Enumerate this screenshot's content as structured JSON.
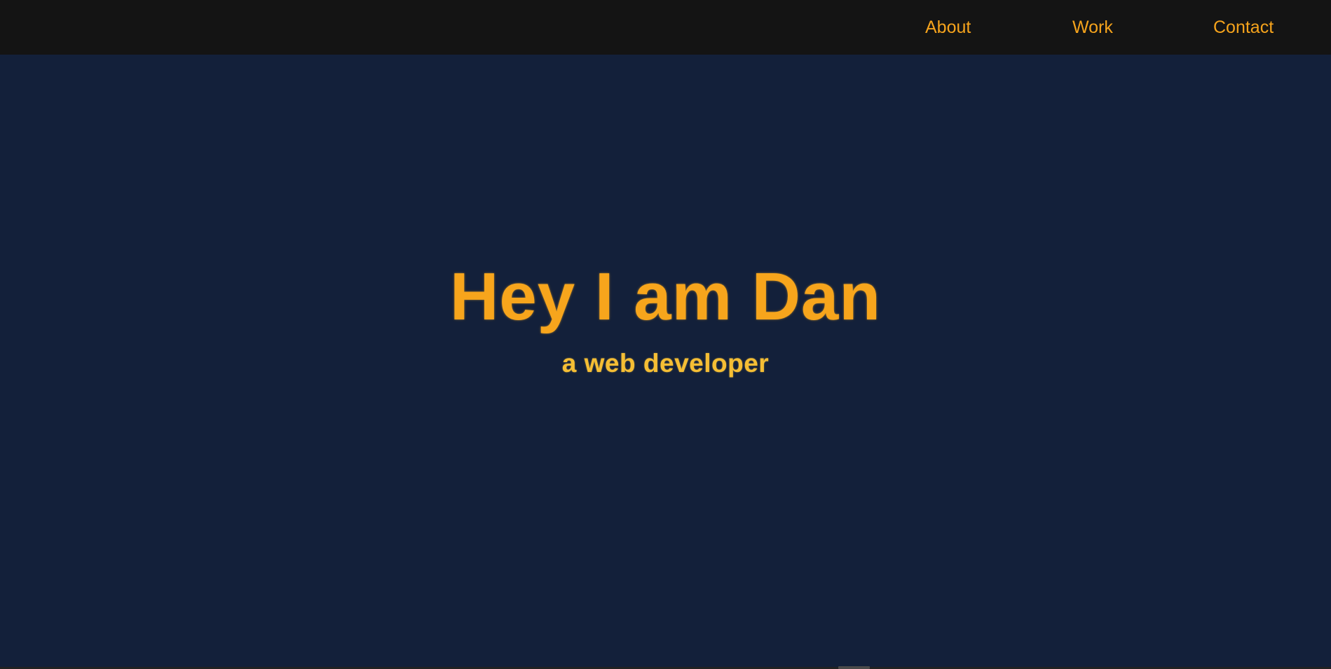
{
  "nav": {
    "links": [
      {
        "label": "About"
      },
      {
        "label": "Work"
      },
      {
        "label": "Contact"
      }
    ]
  },
  "hero": {
    "title": "Hey I am Dan",
    "subtitle": "a web developer"
  },
  "colors": {
    "page_background": "#13203a",
    "navbar_background": "#141414",
    "accent_orange": "#f7a51c",
    "subtitle_gold": "#f5be34"
  }
}
